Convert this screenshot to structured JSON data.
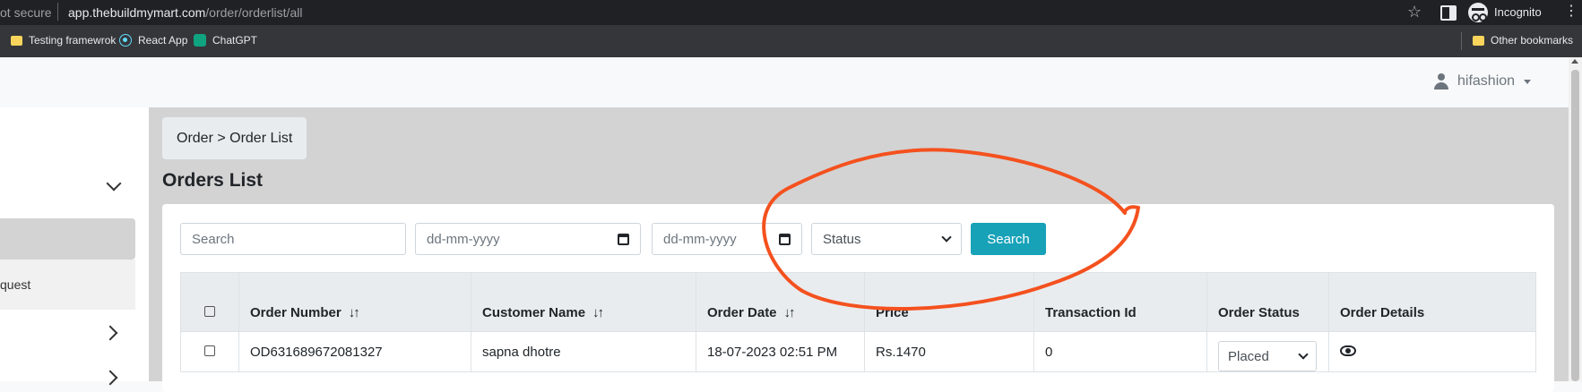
{
  "browser": {
    "security": "ot secure",
    "url_domain": "app.thebuildmymart.com",
    "url_path": "/order/orderlist/all",
    "incognito": "Incognito",
    "bookmarks": [
      "Testing framewrok",
      "React App",
      "ChatGPT"
    ],
    "other_bookmarks": "Other bookmarks"
  },
  "header": {
    "username": "hifashion"
  },
  "sidebar": {
    "partial_item": "quest"
  },
  "breadcrumb": "Order > Order List",
  "page_title": "Orders List",
  "filters": {
    "search_placeholder": "Search",
    "from_date_placeholder": "dd-mm-yyyy",
    "to_date_placeholder": "dd-mm-yyyy",
    "status_selected": "Status",
    "search_button": "Search"
  },
  "table": {
    "columns": [
      "Order Number",
      "Customer Name",
      "Order Date",
      "Price",
      "Transaction Id",
      "Order Status",
      "Order Details"
    ],
    "sort_icon": "↓↑",
    "rows": [
      {
        "order_number": "OD631689672081327",
        "customer_name": "sapna dhotre",
        "order_date": "18-07-2023 02:51 PM",
        "price": "Rs.1470",
        "transaction_id": "0",
        "order_status": "Placed"
      }
    ]
  },
  "colors": {
    "accent": "#17a2b8",
    "annotation": "#f4511e",
    "content_bg": "#d3d3d3"
  }
}
